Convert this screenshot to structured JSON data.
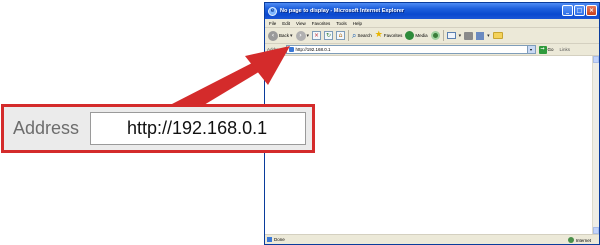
{
  "window": {
    "title": "No page to display - Microsoft Internet Explorer",
    "logo_letter": "e",
    "controls": {
      "minimize": "_",
      "maximize": "□",
      "close": "×"
    }
  },
  "menu": [
    "File",
    "Edit",
    "View",
    "Favorites",
    "Tools",
    "Help"
  ],
  "toolbar": {
    "back_label": "Back",
    "search_label": "Search",
    "favorites_label": "Favorites",
    "media_label": "Media"
  },
  "address_bar": {
    "label": "Address",
    "url": "http://192.168.0.1",
    "go_label": "Go",
    "links_label": "Links"
  },
  "status_bar": {
    "text": "Done",
    "zone": "Internet"
  },
  "callout": {
    "label": "Address",
    "url": "http://192.168.0.1"
  },
  "colors": {
    "callout_border": "#d42b2b",
    "arrow": "#d42b2b",
    "titlebar": "#1e5fdc"
  },
  "icons": [
    "back-icon",
    "forward-icon",
    "stop-icon",
    "refresh-icon",
    "home-icon",
    "search-icon",
    "favorites-star-icon",
    "media-icon",
    "history-icon",
    "mail-icon",
    "print-icon",
    "edit-icon",
    "folder-icon",
    "go-arrow-icon",
    "globe-icon"
  ]
}
